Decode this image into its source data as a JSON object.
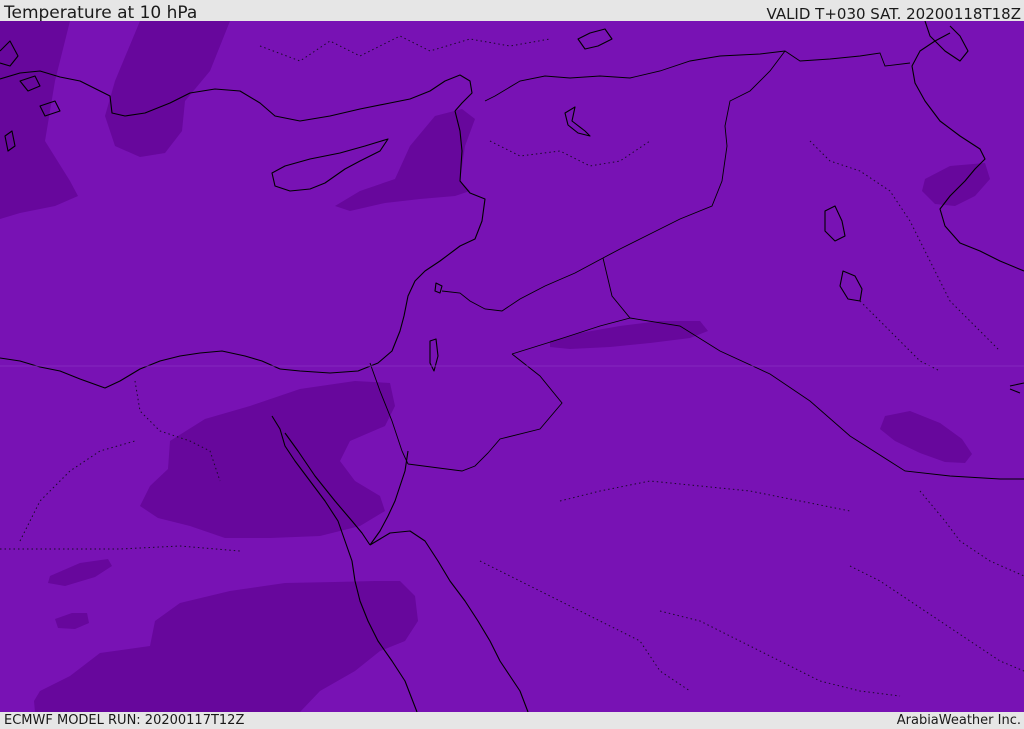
{
  "header": {
    "title": "Temperature at 10 hPa",
    "valid": "VALID T+030 SAT. 20200118T18Z"
  },
  "footer": {
    "model_run": "ECMWF MODEL RUN: 20200117T12Z",
    "credit": "ArabiaWeather Inc."
  },
  "map": {
    "base_color": "#7812b4",
    "cold_color": "#67079c",
    "coastline_color": "#000000"
  }
}
